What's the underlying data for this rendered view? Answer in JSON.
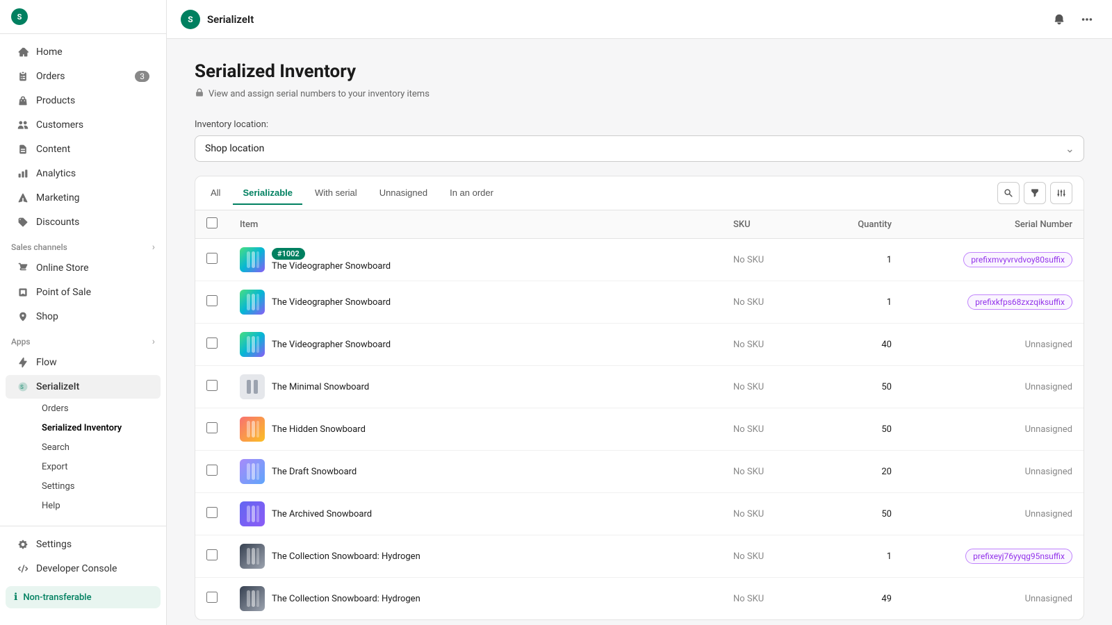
{
  "sidebar": {
    "app_name": "SerializeIt",
    "logo_text": "S",
    "nav_items": [
      {
        "id": "home",
        "label": "Home",
        "icon": "home-icon",
        "badge": null
      },
      {
        "id": "orders",
        "label": "Orders",
        "icon": "orders-icon",
        "badge": "3"
      },
      {
        "id": "products",
        "label": "Products",
        "icon": "products-icon",
        "badge": null
      },
      {
        "id": "customers",
        "label": "Customers",
        "icon": "customers-icon",
        "badge": null
      },
      {
        "id": "content",
        "label": "Content",
        "icon": "content-icon",
        "badge": null
      },
      {
        "id": "analytics",
        "label": "Analytics",
        "icon": "analytics-icon",
        "badge": null
      },
      {
        "id": "marketing",
        "label": "Marketing",
        "icon": "marketing-icon",
        "badge": null
      },
      {
        "id": "discounts",
        "label": "Discounts",
        "icon": "discounts-icon",
        "badge": null
      }
    ],
    "sales_channels_label": "Sales channels",
    "sales_channels": [
      {
        "id": "online-store",
        "label": "Online Store",
        "icon": "store-icon"
      },
      {
        "id": "point-of-sale",
        "label": "Point of Sale",
        "icon": "pos-icon"
      },
      {
        "id": "shop",
        "label": "Shop",
        "icon": "shop-icon"
      }
    ],
    "apps_label": "Apps",
    "apps": [
      {
        "id": "flow",
        "label": "Flow",
        "icon": "flow-icon"
      },
      {
        "id": "serializeit",
        "label": "SerializeIt",
        "icon": "serialize-icon",
        "active": true
      }
    ],
    "sub_items": [
      {
        "id": "orders-sub",
        "label": "Orders",
        "active": false
      },
      {
        "id": "serialized-inventory",
        "label": "Serialized Inventory",
        "active": true
      },
      {
        "id": "search-sub",
        "label": "Search",
        "active": false
      },
      {
        "id": "export",
        "label": "Export",
        "active": false
      },
      {
        "id": "settings-sub",
        "label": "Settings",
        "active": false
      },
      {
        "id": "help",
        "label": "Help",
        "active": false
      }
    ],
    "bottom_items": [
      {
        "id": "settings",
        "label": "Settings",
        "icon": "settings-icon"
      },
      {
        "id": "developer-console",
        "label": "Developer Console",
        "icon": "developer-icon"
      }
    ],
    "non_transferable_label": "Non-transferable"
  },
  "topbar": {
    "logo_text": "S",
    "title": "SerializeIt",
    "bell_icon": "bell-icon",
    "more_icon": "more-icon"
  },
  "page": {
    "title": "Serialized Inventory",
    "subtitle": "View and assign serial numbers to your inventory items",
    "subtitle_icon": "lock-icon"
  },
  "location": {
    "label": "Inventory location:",
    "value": "Shop location",
    "options": [
      "Shop location"
    ]
  },
  "filters": {
    "tabs": [
      {
        "id": "all",
        "label": "All",
        "active": false
      },
      {
        "id": "serializable",
        "label": "Serializable",
        "active": true
      },
      {
        "id": "with-serial",
        "label": "With serial",
        "active": false
      },
      {
        "id": "unnasigned",
        "label": "Unnasigned",
        "active": false
      },
      {
        "id": "in-an-order",
        "label": "In an order",
        "active": false
      }
    ]
  },
  "table": {
    "columns": [
      {
        "id": "checkbox",
        "label": ""
      },
      {
        "id": "item",
        "label": "Item"
      },
      {
        "id": "sku",
        "label": "SKU"
      },
      {
        "id": "quantity",
        "label": "Quantity"
      },
      {
        "id": "serial-number",
        "label": "Serial Number"
      }
    ],
    "rows": [
      {
        "id": 1,
        "tag": "#1002",
        "tag_color": "green",
        "name": "The Videographer Snowboard",
        "sku": "No SKU",
        "quantity": 1,
        "serial": "prefixmvyvrvdvoy80suffix",
        "serial_type": "chip",
        "thumb_type": "videographer"
      },
      {
        "id": 2,
        "tag": null,
        "name": "The Videographer Snowboard",
        "sku": "No SKU",
        "quantity": 1,
        "serial": "prefixkfps68zxzqiksuffix",
        "serial_type": "chip",
        "thumb_type": "videographer"
      },
      {
        "id": 3,
        "tag": null,
        "name": "The Videographer Snowboard",
        "sku": "No SKU",
        "quantity": 40,
        "serial": "Unnasigned",
        "serial_type": "text",
        "thumb_type": "videographer"
      },
      {
        "id": 4,
        "tag": null,
        "name": "The Minimal Snowboard",
        "sku": "No SKU",
        "quantity": 50,
        "serial": "Unnasigned",
        "serial_type": "text",
        "thumb_type": "minimal"
      },
      {
        "id": 5,
        "tag": null,
        "name": "The Hidden Snowboard",
        "sku": "No SKU",
        "quantity": 50,
        "serial": "Unnasigned",
        "serial_type": "text",
        "thumb_type": "hidden"
      },
      {
        "id": 6,
        "tag": null,
        "name": "The Draft Snowboard",
        "sku": "No SKU",
        "quantity": 20,
        "serial": "Unnasigned",
        "serial_type": "text",
        "thumb_type": "draft"
      },
      {
        "id": 7,
        "tag": null,
        "name": "The Archived Snowboard",
        "sku": "No SKU",
        "quantity": 50,
        "serial": "Unnasigned",
        "serial_type": "text",
        "thumb_type": "archived"
      },
      {
        "id": 8,
        "tag": null,
        "name": "The Collection Snowboard: Hydrogen",
        "sku": "No SKU",
        "quantity": 1,
        "serial": "prefixeyj76yyqg95nsuffix",
        "serial_type": "chip",
        "thumb_type": "hydrogen"
      },
      {
        "id": 9,
        "tag": null,
        "name": "The Collection Snowboard: Hydrogen",
        "sku": "No SKU",
        "quantity": 49,
        "serial": "Unnasigned",
        "serial_type": "text",
        "thumb_type": "hydrogen"
      }
    ]
  }
}
